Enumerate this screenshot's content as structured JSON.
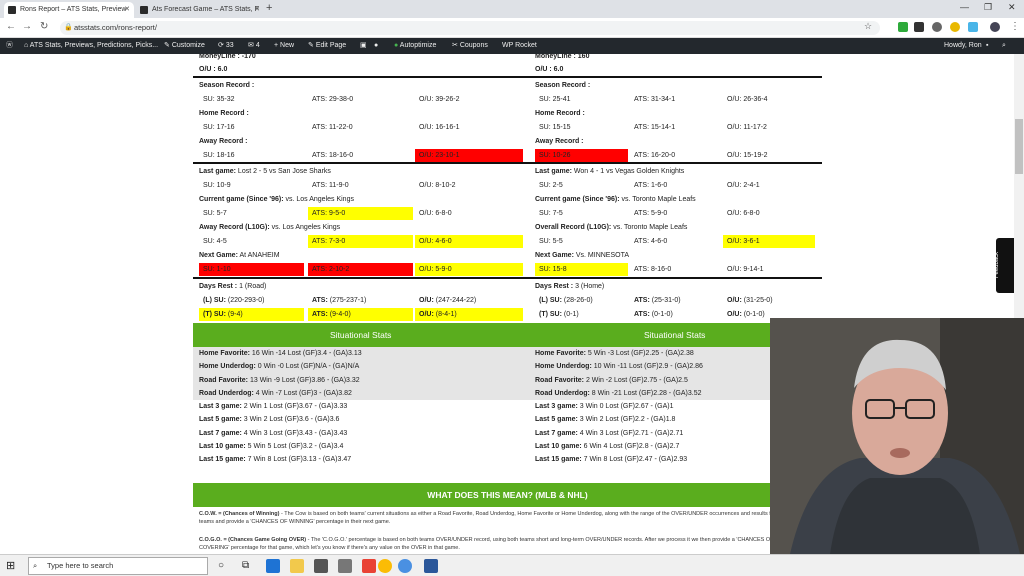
{
  "browser": {
    "tabs": [
      {
        "title": "Rons Report – ATS Stats, Preview"
      },
      {
        "title": "Ats Forecast Game – ATS Stats, F"
      }
    ],
    "url": "atsstats.com/rons-report/"
  },
  "wpbar": {
    "site": "ATS Stats, Previews, Predictions, Picks...",
    "customize": "Customize",
    "updates": "33",
    "comments": "4",
    "new": "New",
    "edit": "Edit Page",
    "autoptimize": "Autoptimize",
    "coupons": "Coupons",
    "wprocket": "WP Rocket",
    "howdy": "Howdy, Ron"
  },
  "left": {
    "moneyline": "MoneyLine : -170",
    "ou": "O/U : 6.0",
    "season_label": "Season Record :",
    "season": {
      "su": "SU: 35-32",
      "ats": "ATS: 29-38-0",
      "ou": "O/U: 39-26-2"
    },
    "home_label": "Home Record :",
    "home": {
      "su": "SU: 17-16",
      "ats": "ATS: 11-22-0",
      "ou": "O/U: 16-16-1"
    },
    "away_label": "Away Record :",
    "away": {
      "su": "SU: 18-16",
      "ats": "ATS: 18-16-0",
      "ou": "O/U: 23-10-1"
    },
    "last_game_label": "Last game:",
    "last_game": "Lost 2 - 5 vs San Jose Sharks",
    "last": {
      "su": "SU: 10-9",
      "ats": "ATS: 11-9-0",
      "ou": "O/U: 8-10-2"
    },
    "current_label": "Current game (Since '96):",
    "current_vs": "vs. Los Angeles Kings",
    "current": {
      "su": "SU: 5-7",
      "ats": "ATS: 9-5-0",
      "ou": "O/U: 6-8-0"
    },
    "l10_label": "Away Record (L10G):",
    "l10_vs": "vs. Los Angeles Kings",
    "l10": {
      "su": "SU: 4-5",
      "ats": "ATS: 7-3-0",
      "ou": "O/U: 4-6-0"
    },
    "next_label": "Next Game:",
    "next_vs": "At ANAHEIM",
    "next": {
      "su": "SU: 1-10",
      "ats": "ATS: 2-10-2",
      "ou": "O/U: 5-9-0"
    },
    "rest_label": "Days Rest :",
    "rest_val": "1 (Road)",
    "rest_l": {
      "su": "(L) SU:",
      "su_v": "(220-293-0)",
      "ats": "ATS:",
      "ats_v": "(275-237-1)",
      "ou": "O/U:",
      "ou_v": "(247-244-22)"
    },
    "rest_t": {
      "su": "(T) SU:",
      "su_v": "(9-4)",
      "ats": "ATS:",
      "ats_v": "(9-4-0)",
      "ou": "O/U:",
      "ou_v": "(8-4-1)"
    },
    "sit_title": "Situational Stats",
    "sit": [
      {
        "label": "Home Favorite:",
        "text": "16 Win -14 Lost   (GF)3.4 - (GA)3.13"
      },
      {
        "label": "Home Underdog:",
        "text": "0 Win -0 Lost   (GF)N/A - (GA)N/A"
      },
      {
        "label": "Road Favorite:",
        "text": "13 Win -9 Lost   (GF)3.86 - (GA)3.32"
      },
      {
        "label": "Road Underdog:",
        "text": "4 Win -7 Lost   (GF)3 - (GA)3.82"
      }
    ],
    "lastn": [
      {
        "label": "Last 3 game:",
        "text": "2 Win 1 Lost   (GF)3.67 - (GA)3.33"
      },
      {
        "label": "Last 5 game:",
        "text": "3 Win 2 Lost   (GF)3.6 - (GA)3.6"
      },
      {
        "label": "Last 7 game:",
        "text": "4 Win 3 Lost   (GF)3.43 - (GA)3.43"
      },
      {
        "label": "Last 10 game:",
        "text": "5 Win 5 Lost   (GF)3.2 - (GA)3.4"
      },
      {
        "label": "Last 15 game:",
        "text": "7 Win 8 Lost   (GF)3.13 - (GA)3.47"
      }
    ]
  },
  "right": {
    "moneyline": "MoneyLine : 160",
    "ou": "O/U : 6.0",
    "season_label": "Season Record :",
    "season": {
      "su": "SU: 25-41",
      "ats": "ATS: 31-34-1",
      "ou": "O/U: 26-36-4"
    },
    "home_label": "Home Record :",
    "home": {
      "su": "SU: 15-15",
      "ats": "ATS: 15-14-1",
      "ou": "O/U: 11-17-2"
    },
    "away_label": "Away Record :",
    "away": {
      "su": "SU: 10-26",
      "ats": "ATS: 16-20-0",
      "ou": "O/U: 15-19-2"
    },
    "last_game_label": "Last game:",
    "last_game": "Won 4 - 1 vs Vegas Golden Knights",
    "last": {
      "su": "SU: 2-5",
      "ats": "ATS: 1-6-0",
      "ou": "O/U: 2-4-1"
    },
    "current_label": "Current game (Since '96):",
    "current_vs": "vs. Toronto Maple Leafs",
    "current": {
      "su": "SU: 7-5",
      "ats": "ATS: 5-9-0",
      "ou": "O/U: 6-8-0"
    },
    "l10_label": "Overall Record (L10G):",
    "l10_vs": "vs. Toronto Maple Leafs",
    "l10": {
      "su": "SU: 5-5",
      "ats": "ATS: 4-6-0",
      "ou": "O/U: 3-6-1"
    },
    "next_label": "Next Game:",
    "next_vs": "Vs. MINNESOTA",
    "next": {
      "su": "SU: 15-8",
      "ats": "ATS: 8-16-0",
      "ou": "O/U: 9-14-1"
    },
    "rest_label": "Days Rest :",
    "rest_val": "3 (Home)",
    "rest_l": {
      "su": "(L) SU:",
      "su_v": "(28-26-0)",
      "ats": "ATS:",
      "ats_v": "(25-31-0)",
      "ou": "O/U:",
      "ou_v": "(31-25-0)"
    },
    "rest_t": {
      "su": "(T) SU:",
      "su_v": "(0-1)",
      "ats": "ATS:",
      "ats_v": "(0-1-0)",
      "ou": "O/U:",
      "ou_v": "(0-1-0)"
    },
    "sit_title": "Situational Stats",
    "sit": [
      {
        "label": "Home Favorite:",
        "text": "5 Win -3 Lost   (GF)2.25 - (GA)2.38"
      },
      {
        "label": "Home Underdog:",
        "text": "10 Win -11 Lost   (GF)2.9 - (GA)2.86"
      },
      {
        "label": "Road Favorite:",
        "text": "2 Win -2 Lost   (GF)2.75 - (GA)2.5"
      },
      {
        "label": "Road Underdog:",
        "text": "8 Win -21 Lost   (GF)2.28 - (GA)3.52"
      }
    ],
    "lastn": [
      {
        "label": "Last 3 game:",
        "text": "3 Win 0 Lost   (GF)2.67 - (GA)1"
      },
      {
        "label": "Last 5 game:",
        "text": "3 Win 2 Lost   (GF)2.2 - (GA)1.8"
      },
      {
        "label": "Last 7 game:",
        "text": "4 Win 3 Lost   (GF)2.71 - (GA)2.71"
      },
      {
        "label": "Last 10 game:",
        "text": "6 Win 4 Lost   (GF)2.8 - (GA)2.7"
      },
      {
        "label": "Last 15 game:",
        "text": "7 Win 8 Lost   (GF)2.47 - (GA)2.93"
      }
    ]
  },
  "what": {
    "title": "WHAT DOES THIS MEAN? (MLB & NHL)",
    "cow_label": "C.O.W. = (Chances of Winning)",
    "cow_text": " - The Cow is based on both teams' current situations as either a Road Favorite, Road Underdog, Home Favorite or Home Underdog, along with the range of the OVER/UNDER occurrences and results from both teams and provide a 'CHANCES OF WINNING' percentage in their next game.",
    "cogo_label": "C.O.G.O. = (Chances Game Going OVER)",
    "cogo_text": " - The 'C.O.G.O.' percentage is based on both teams OVER/UNDER record, using both teams short and long-term OVER/UNDER records. After we process it we then provide a 'CHANCES OF COVERING' percentage for that game, which let's you know if there's any value on the OVER in that game."
  },
  "feedback": "Feedback",
  "taskbar": {
    "search_placeholder": "Type here to search"
  },
  "colors": {
    "highlight_yellow": "#ffff00",
    "highlight_red": "#ff0000",
    "green_bar": "#5aad1e",
    "wp_bar": "#23282d"
  }
}
